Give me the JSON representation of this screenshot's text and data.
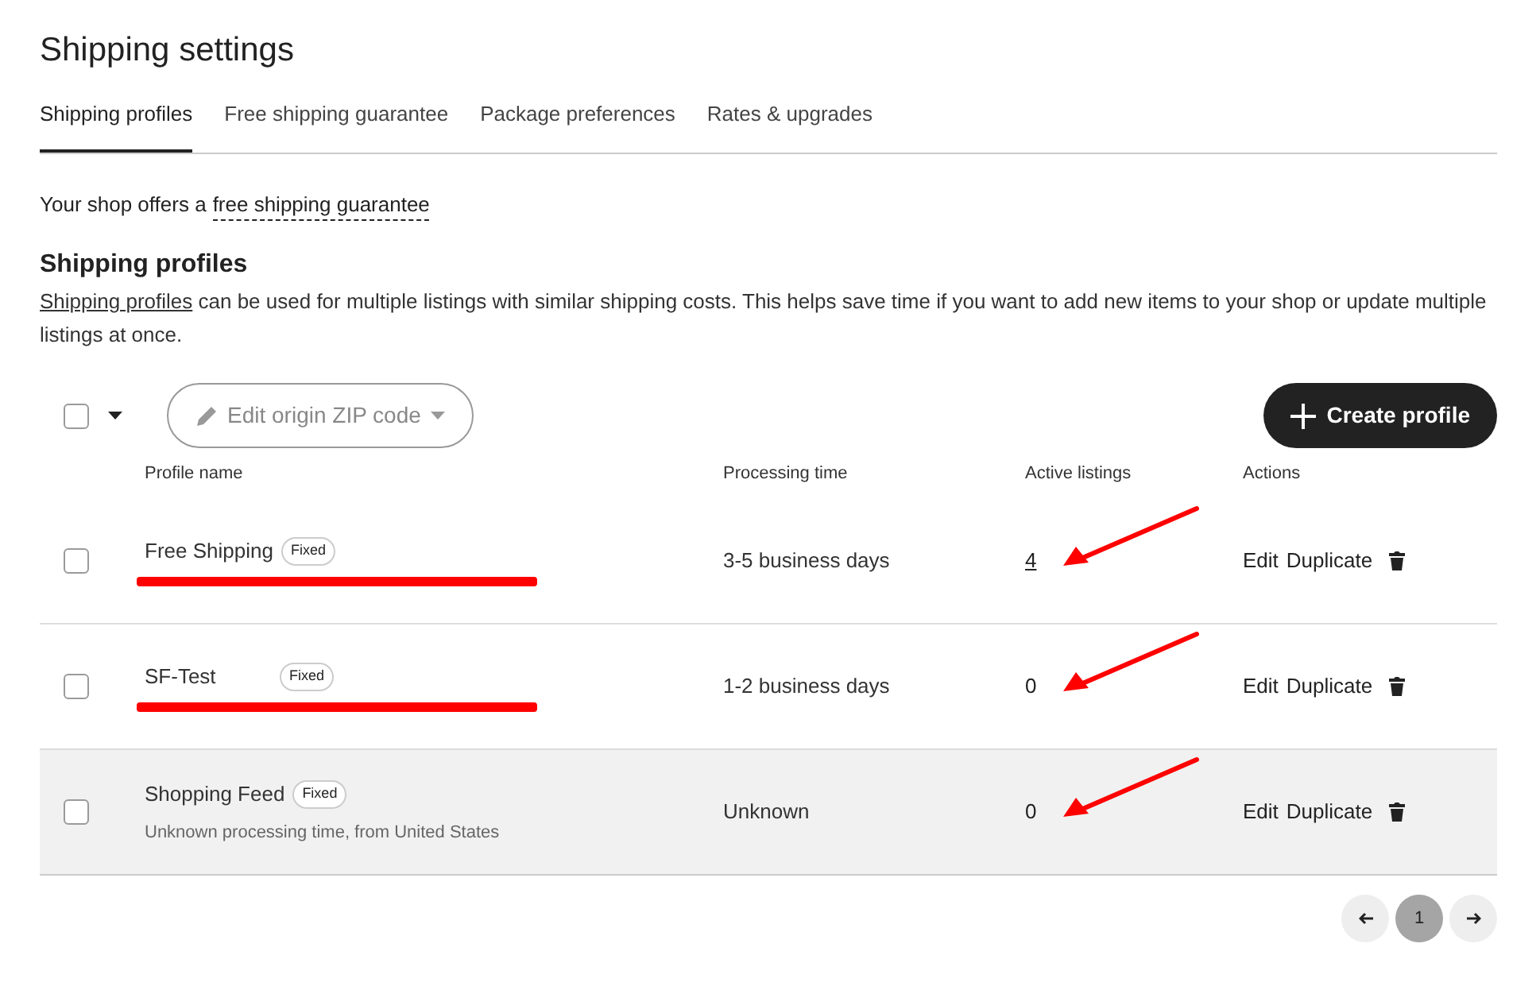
{
  "title": "Shipping settings",
  "tabs": [
    {
      "label": "Shipping profiles",
      "selected": true
    },
    {
      "label": "Free shipping guarantee",
      "selected": false
    },
    {
      "label": "Package preferences",
      "selected": false
    },
    {
      "label": "Rates & upgrades",
      "selected": false
    }
  ],
  "guarantee_notice": {
    "text": "Your shop offers a",
    "link": "free shipping guarantee"
  },
  "section": {
    "heading": "Shipping profiles",
    "link": "Shipping profiles",
    "text": "can be used for multiple listings with similar shipping costs. This helps save time if you want to add new items to your shop or update multiple listings at once."
  },
  "toolbar": {
    "select_all_checked": false,
    "zip_button": "Edit origin ZIP code",
    "create_button": "Create profile"
  },
  "table": {
    "columns": [
      "Profile name",
      "Processing time",
      "Active listings",
      "Actions"
    ],
    "rows": [
      {
        "name": "Free Shipping",
        "badge": "Fixed",
        "redacted": true,
        "processing": "3-5 business days",
        "listings": "4",
        "listings_link": true,
        "checked": false,
        "highlighted": false,
        "arrow": true,
        "actions": [
          "Edit",
          "Duplicate"
        ]
      },
      {
        "name": "SF-Test",
        "badge": "Fixed",
        "redacted": true,
        "processing": "1-2 business days",
        "listings": "0",
        "listings_link": false,
        "checked": false,
        "highlighted": false,
        "arrow": true,
        "actions": [
          "Edit",
          "Duplicate"
        ]
      },
      {
        "name": "Shopping Feed",
        "badge": "Fixed",
        "redacted": false,
        "subtitle": "Unknown processing time, from United States",
        "processing": "Unknown",
        "listings": "0",
        "listings_link": false,
        "checked": false,
        "highlighted": true,
        "arrow": true,
        "actions": [
          "Edit",
          "Duplicate"
        ]
      }
    ]
  },
  "pagination": {
    "pages": [
      {
        "label": "1",
        "selected": true
      }
    ]
  }
}
